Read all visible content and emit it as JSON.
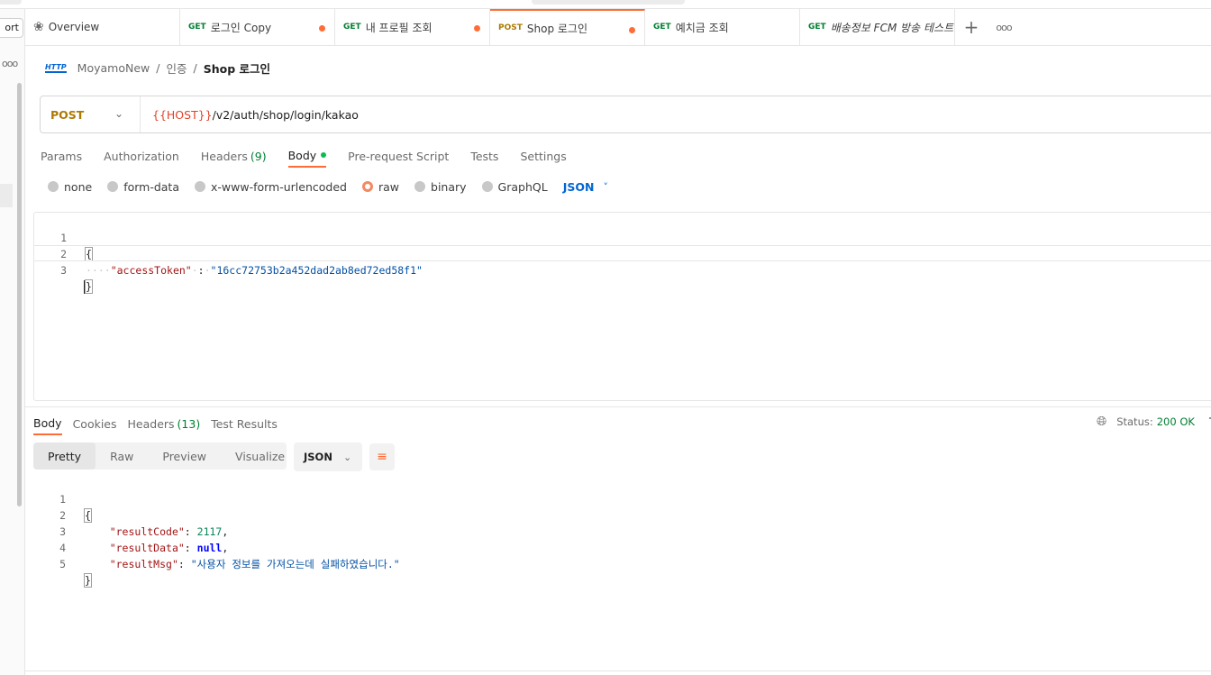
{
  "sidebar": {
    "import_label": "ort",
    "more_label": "ooo"
  },
  "tabs": [
    {
      "type": "overview",
      "method": "",
      "name": "Overview",
      "unsaved": false,
      "active": false,
      "italic": false
    },
    {
      "type": "request",
      "method": "GET",
      "name": "로그인 Copy",
      "unsaved": true,
      "active": false,
      "italic": false
    },
    {
      "type": "request",
      "method": "GET",
      "name": "내 프로필 조회",
      "unsaved": true,
      "active": false,
      "italic": false
    },
    {
      "type": "request",
      "method": "POST",
      "name": "Shop 로그인",
      "unsaved": true,
      "active": true,
      "italic": false
    },
    {
      "type": "request",
      "method": "GET",
      "name": "예치금 조회",
      "unsaved": false,
      "active": false,
      "italic": false
    },
    {
      "type": "request",
      "method": "GET",
      "name": "배송정보 FCM 방송 테스트",
      "unsaved": false,
      "active": false,
      "italic": true
    }
  ],
  "tabbar": {
    "add_label": "+",
    "more_label": "ooo"
  },
  "breadcrumb": {
    "icon_label": "HTTP",
    "items": [
      "MoyamoNew",
      "인증"
    ],
    "current": "Shop 로그인",
    "separator": "/"
  },
  "request": {
    "method": "POST",
    "url_var": "{{HOST}}",
    "url_path": "/v2/auth/shop/login/kakao"
  },
  "request_tabs": [
    {
      "label": "Params",
      "count": "",
      "active": false,
      "dot": false
    },
    {
      "label": "Authorization",
      "count": "",
      "active": false,
      "dot": false
    },
    {
      "label": "Headers",
      "count": "(9)",
      "active": false,
      "dot": false
    },
    {
      "label": "Body",
      "count": "",
      "active": true,
      "dot": true
    },
    {
      "label": "Pre-request Script",
      "count": "",
      "active": false,
      "dot": false
    },
    {
      "label": "Tests",
      "count": "",
      "active": false,
      "dot": false
    },
    {
      "label": "Settings",
      "count": "",
      "active": false,
      "dot": false
    }
  ],
  "body_types": [
    {
      "label": "none",
      "selected": false
    },
    {
      "label": "form-data",
      "selected": false
    },
    {
      "label": "x-www-form-urlencoded",
      "selected": false
    },
    {
      "label": "raw",
      "selected": true
    },
    {
      "label": "binary",
      "selected": false
    },
    {
      "label": "GraphQL",
      "selected": false
    }
  ],
  "body_format": "JSON",
  "request_body": {
    "line_numbers": [
      "1",
      "2",
      "3"
    ],
    "open_brace": "{",
    "close_brace": "}",
    "indent": "····",
    "key": "\"accessToken\"",
    "colon": ":",
    "value": "\"16cc72753b2a452dad2ab8ed72ed58f1\""
  },
  "response_tabs": [
    {
      "label": "Body",
      "count": "",
      "active": true
    },
    {
      "label": "Cookies",
      "count": "",
      "active": false
    },
    {
      "label": "Headers",
      "count": "(13)",
      "active": false
    },
    {
      "label": "Test Results",
      "count": "",
      "active": false
    }
  ],
  "response_status": {
    "label": "Status:",
    "code": "200 OK",
    "trail": "T"
  },
  "view_modes": [
    {
      "label": "Pretty",
      "active": true
    },
    {
      "label": "Raw",
      "active": false
    },
    {
      "label": "Preview",
      "active": false
    },
    {
      "label": "Visualize",
      "active": false
    }
  ],
  "response_format": "JSON",
  "response_body": {
    "line_numbers": [
      "1",
      "2",
      "3",
      "4",
      "5"
    ],
    "open_brace": "{",
    "close_brace": "}",
    "fields": [
      {
        "key": "\"resultCode\"",
        "value": "2117",
        "type": "num",
        "comma": ","
      },
      {
        "key": "\"resultData\"",
        "value": "null",
        "type": "kw",
        "comma": ","
      },
      {
        "key": "\"resultMsg\"",
        "value": "\"사용자 정보를 가져오는데 실패하였습니다.\"",
        "type": "str",
        "comma": ""
      }
    ]
  },
  "colors": {
    "accent": "#ff6c37",
    "get_method": "#007f31",
    "post_method": "#ad7a03",
    "status_ok": "#007f31",
    "link_blue": "#0265d2"
  },
  "icons": {
    "overview": "overview-icon",
    "globe": "globe-icon",
    "wrap": "wrap-lines-icon",
    "chevron": "chevron-down-icon"
  }
}
